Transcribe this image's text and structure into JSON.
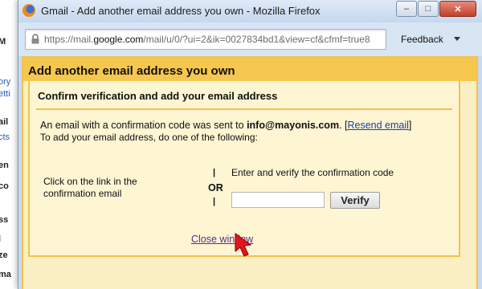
{
  "background_page": {
    "labels": [
      {
        "text": "M",
        "kind": "bold"
      },
      {
        "text": "ory",
        "kind": "link"
      },
      {
        "text": "etti",
        "kind": "link"
      },
      {
        "text": "ail",
        "kind": "bold"
      },
      {
        "text": "cts",
        "kind": "link"
      },
      {
        "text": "en",
        "kind": "bold"
      },
      {
        "text": "co",
        "kind": "bold"
      },
      {
        "text": "ss",
        "kind": "bold"
      },
      {
        "text": "l",
        "kind": "bold"
      },
      {
        "text": "ze",
        "kind": "bold"
      },
      {
        "text": "ma",
        "kind": "bold"
      }
    ]
  },
  "window": {
    "title": "Gmail - Add another email address you own - Mozilla Firefox",
    "controls": {
      "minimize": "–",
      "maximize": "□",
      "close": "✕"
    },
    "url": {
      "prefix": "https://mail.",
      "domain": "google.com",
      "suffix": "/mail/u/0/?ui=2&ik=0027834bd1&view=cf&cfmf=true8"
    },
    "feedback_label": "Feedback"
  },
  "dialog": {
    "title": "Add another email address you own",
    "section_title": "Confirm verification and add your email address",
    "message_prefix": "An email with a confirmation code was sent to ",
    "email": "info@mayonis.com",
    "message_mid": ". [",
    "resend_link": "Resend email",
    "message_end": "]",
    "instruction": "To add your email address, do one of the following:",
    "option_link_text": "Click on the link in the confirmation email",
    "or_label": "OR",
    "or_bar": "|",
    "option_code_text": "Enter and verify the confirmation code",
    "code_input_value": "",
    "verify_label": "Verify",
    "close_window_link": "Close window"
  },
  "colors": {
    "dialog_header": "#f6c74f",
    "dialog_bg": "#f9efc3",
    "inner_bg": "#fef5d3",
    "link": "#1a3ea8",
    "visited_link": "#5a2b8c",
    "cursor": "#e8141c"
  },
  "icons": {
    "browser": "firefox-icon",
    "lock": "lock-icon",
    "feedback_caret": "caret-down-icon",
    "pointer": "cursor-arrow-icon"
  }
}
